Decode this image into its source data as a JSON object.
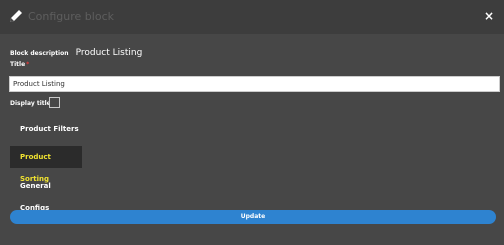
{
  "dialog": {
    "title": "Configure block",
    "close_label": "×",
    "icons": {
      "title": "pencil-icon"
    }
  },
  "block_description": {
    "label": "Block description",
    "value": "Product Listing"
  },
  "title_field": {
    "label": "Title",
    "required_marker": "*",
    "value": "Product Listing"
  },
  "display_title": {
    "label": "Display title",
    "checked": false
  },
  "tabs": [
    {
      "label": "Product Filters",
      "active": false
    },
    {
      "label": "Product Sorting",
      "active": true
    },
    {
      "label": "General Configs",
      "active": false
    }
  ],
  "actions": {
    "update_label": "Update"
  },
  "colors": {
    "background": "#474747",
    "active_tab_text": "#f0e230",
    "update_button": "#2e83d0",
    "required": "#e03a3a"
  }
}
